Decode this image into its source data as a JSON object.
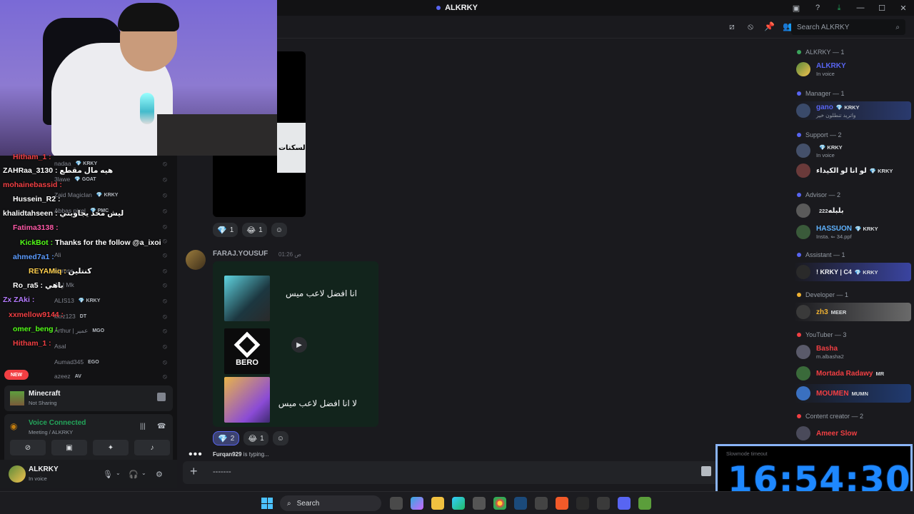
{
  "window": {
    "title": "ALKRKY",
    "search_placeholder": "Search ALKRKY"
  },
  "chat": {
    "reactions_top": [
      {
        "emoji": "💎",
        "count": "1"
      },
      {
        "emoji": "😂",
        "count": "1"
      }
    ],
    "screenshot_text": "السكنات",
    "message": {
      "author": "FARAJ.YOUSUF",
      "time": "01:26 ص"
    },
    "embed": {
      "line1": "انا افضل لاعب ميس",
      "thumb2_label": "BERO",
      "line2": "لا انا افضل لاعب ميس"
    },
    "reactions_bottom": [
      {
        "emoji": "💎",
        "count": "2"
      },
      {
        "emoji": "😂",
        "count": "1"
      }
    ],
    "typing_user": "Furqan929",
    "typing_suffix": "is typing...",
    "composer_text": "-------"
  },
  "members": {
    "groups": [
      {
        "label": "ALKRKY — 1",
        "color": "#3ba55c"
      },
      {
        "label": "Manager — 1",
        "color": "#5865f2"
      },
      {
        "label": "Support — 2",
        "color": "#5865f2"
      },
      {
        "label": "Advisor — 2",
        "color": "#5865f2"
      },
      {
        "label": "Assistant — 1",
        "color": "#5865f2"
      },
      {
        "label": "Developer — 1",
        "color": "#f0b232"
      },
      {
        "label": "YouTuber — 3",
        "color": "#f23f43"
      },
      {
        "label": "Content creator — 2",
        "color": "#f23f43"
      }
    ],
    "people": [
      {
        "name": "ALKRKY",
        "sub": "In voice",
        "tag": "",
        "color": "#5865f2"
      },
      {
        "name": "gano",
        "sub": "واتريد تنطلون خير",
        "tag": "💎 KRKY",
        "color": "#5865f2"
      },
      {
        "name": "",
        "sub": "In voice",
        "tag": "💎 KRKY",
        "color": "#5865f2"
      },
      {
        "name": "لو انا لو الكيداء",
        "sub": "",
        "tag": "💎 KRKY",
        "color": "#f2f3f5"
      },
      {
        "name": "بلبله",
        "sub": "",
        "tag": "222",
        "color": "#f2f3f5"
      },
      {
        "name": "HASSUON",
        "sub": "Insta. ⇐ 34.ppf",
        "tag": "💎 KRKY",
        "color": "#5fb3ff"
      },
      {
        "name": "! KRKY | C4",
        "sub": "",
        "tag": "💎 KRKY",
        "color": "#f2f3f5"
      },
      {
        "name": "zh3",
        "sub": "",
        "tag": "MEER",
        "color": "#f0b232"
      },
      {
        "name": "Basha",
        "sub": "m.albasha2",
        "tag": "",
        "color": "#f23f43"
      },
      {
        "name": "Mortada Radawy",
        "sub": "",
        "tag": "MR",
        "color": "#f23f43"
      },
      {
        "name": "MOUMEN",
        "sub": "",
        "tag": "MUMN",
        "color": "#f23f43"
      },
      {
        "name": "Ameer Slow",
        "sub": "",
        "tag": "",
        "color": "#f23f43"
      }
    ]
  },
  "stream_chat": [
    {
      "user": "Hitham_1",
      "msg": "",
      "color": "#f23f43"
    },
    {
      "user": "ZAHRaa_3130",
      "msg": "هيه مال مقطع",
      "color": "#ffffff"
    },
    {
      "user": "mohainebassid",
      "msg": "",
      "color": "#f23f43"
    },
    {
      "user": "Hussein_R2",
      "msg": "",
      "color": "#ffffff"
    },
    {
      "user": "khalidtahseen",
      "msg": "ليش محد يجاوبني",
      "color": "#ffffff"
    },
    {
      "user": "Fatima3138",
      "msg": "",
      "color": "#ff5aa8"
    },
    {
      "user": "KickBot",
      "msg": "Thanks for the follow @a_ixoi",
      "color": "#53fc18"
    },
    {
      "user": "ahmed7a1",
      "msg": "",
      "color": "#5b9bff"
    },
    {
      "user": "REYAMiq",
      "msg": "كنتلين",
      "color": "#ffcf4d"
    },
    {
      "user": "Ro_ra5",
      "msg": "باهي",
      "color": "#ffffff"
    },
    {
      "user": "Zx ZAki",
      "msg": "",
      "color": "#b57bff"
    },
    {
      "user": "xxmellow9144",
      "msg": "",
      "color": "#f23f43"
    },
    {
      "user": "omer_beng",
      "msg": "",
      "color": "#53fc18"
    },
    {
      "user": "Hitham_1",
      "msg": "",
      "color": "#f23f43"
    }
  ],
  "voice_users": [
    {
      "name": "nadaa",
      "tag": "💎 KRKY"
    },
    {
      "name": "3lawe",
      "tag": "💎 GOAT"
    },
    {
      "name": "Zaid Magiclan",
      "tag": "💎 KRKY"
    },
    {
      "name": "Abbas pixel",
      "tag": "💎 PMC"
    },
    {
      "name": "Ali",
      "tag": ""
    },
    {
      "name": "",
      "tag": ""
    },
    {
      "name": "Ali",
      "tag": ""
    },
    {
      "name": "kjamse",
      "tag": ""
    },
    {
      "name": "Ali | Mk",
      "tag": ""
    },
    {
      "name": "ALIS13",
      "tag": "💎 KRKY"
    },
    {
      "name": "kkrz123",
      "tag": "DT"
    },
    {
      "name": "Arthur | عمير",
      "tag": "MGO"
    },
    {
      "name": "Asal",
      "tag": ""
    },
    {
      "name": "Aumad345",
      "tag": "EGO"
    },
    {
      "name": "azeez",
      "tag": "AV"
    }
  ],
  "new_badge": "NEW",
  "game": {
    "title": "Minecraft",
    "status": "Not Sharing"
  },
  "voice": {
    "status": "Voice Connected",
    "channel": "Meeting / ALKRKY"
  },
  "user": {
    "name": "ALKRKY",
    "status": "In voice"
  },
  "timer": {
    "note": "Slowmode timeout",
    "time": "16:54:30"
  },
  "taskbar": {
    "search_label": "Search"
  }
}
